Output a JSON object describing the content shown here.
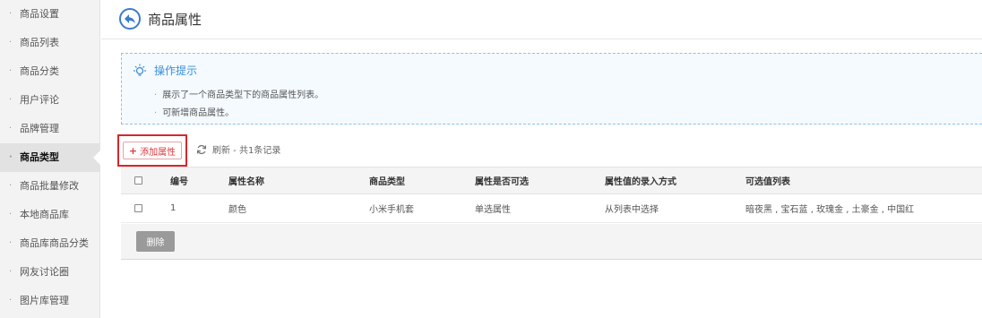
{
  "sidebar": {
    "items": [
      {
        "label": "商品设置"
      },
      {
        "label": "商品列表"
      },
      {
        "label": "商品分类"
      },
      {
        "label": "用户评论"
      },
      {
        "label": "品牌管理"
      },
      {
        "label": "商品类型",
        "active": true
      },
      {
        "label": "商品批量修改"
      },
      {
        "label": "本地商品库"
      },
      {
        "label": "商品库商品分类"
      },
      {
        "label": "网友讨论圈"
      },
      {
        "label": "图片库管理"
      }
    ]
  },
  "header": {
    "title": "商品属性",
    "back_icon": "back-arrow-icon"
  },
  "tips": {
    "title": "操作提示",
    "lines": [
      "展示了一个商品类型下的商品属性列表。",
      "可新增商品属性。"
    ]
  },
  "toolbar": {
    "add_label": "添加属性",
    "refresh_label": "刷新 - 共1条记录"
  },
  "table": {
    "columns": [
      "编号",
      "属性名称",
      "商品类型",
      "属性是否可选",
      "属性值的录入方式",
      "可选值列表"
    ],
    "rows": [
      {
        "id": "1",
        "name": "颜色",
        "type": "小米手机套",
        "selectable": "单选属性",
        "input_method": "从列表中选择",
        "values": "暗夜黑 , 宝石蓝 , 玫瑰金 , 土豪金 , 中国红"
      }
    ]
  },
  "footer": {
    "delete_label": "删除"
  },
  "colors": {
    "accent": "#3b8fd9",
    "danger": "#e0393e",
    "highlight_box": "#d9262c"
  }
}
